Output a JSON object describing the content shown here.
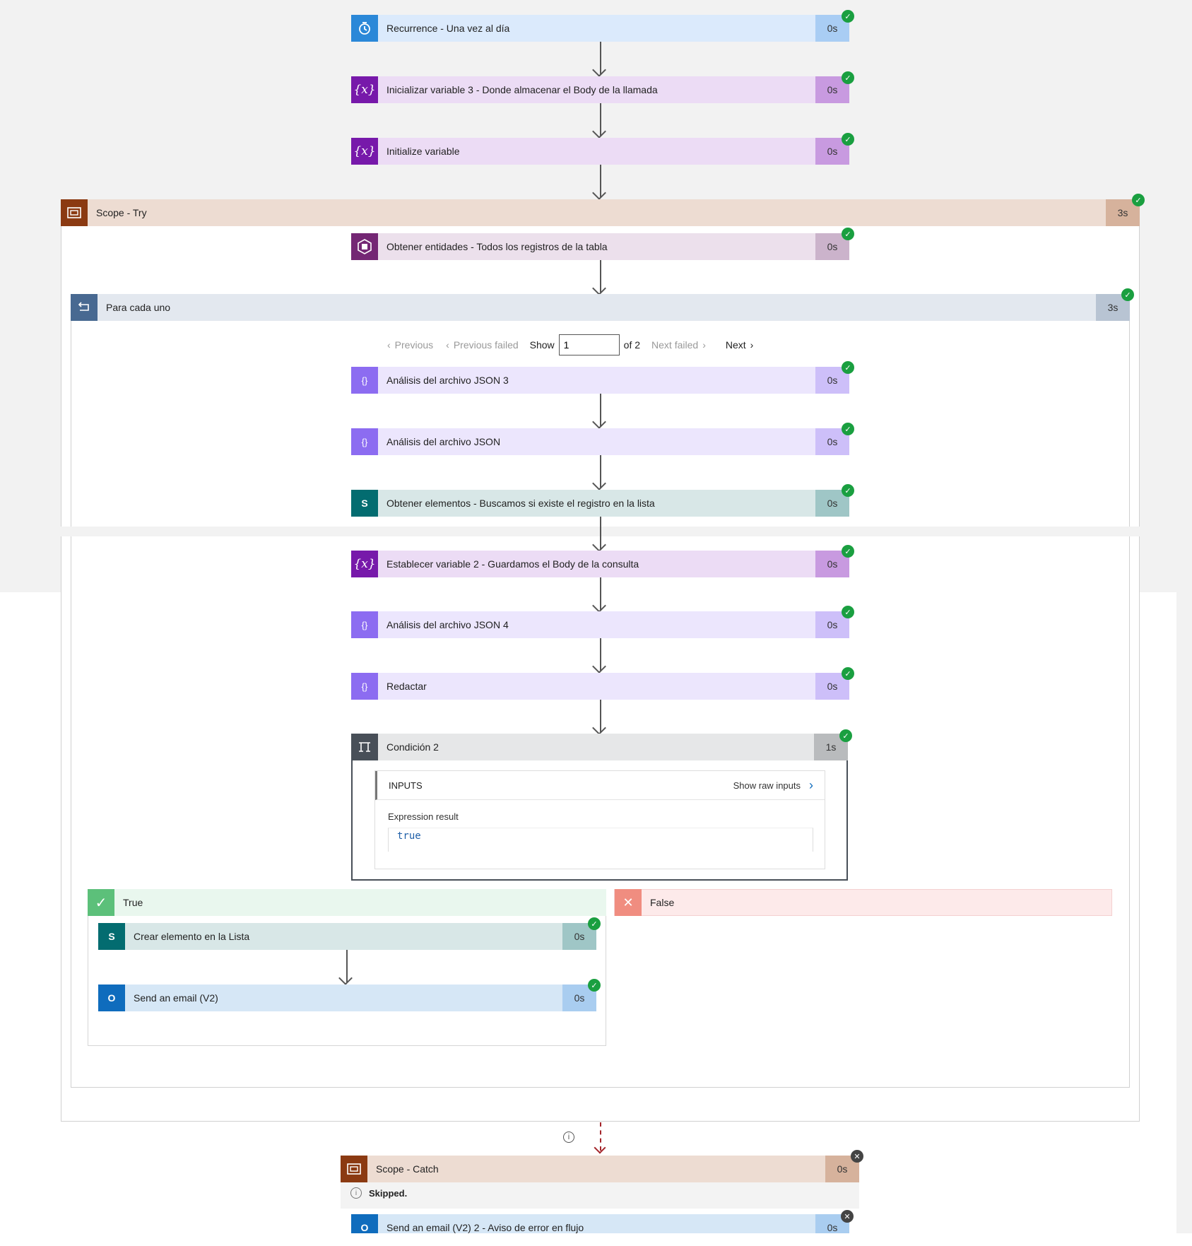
{
  "colors": {
    "recurrence_icon": "#2b88d8",
    "recurrence_bg": "#dbeafc",
    "recurrence_dur": "#a9cdf4",
    "variable_icon": "#7719aa",
    "variable_bg": "#ecdcf5",
    "variable_dur": "#c89ae0",
    "json_icon": "#8c6cf1",
    "json_bg": "#ece6fd",
    "json_dur": "#cdbff9",
    "scope_icon": "#8b3a12",
    "scope_bg": "#eddcd2",
    "scope_dur": "#d6b29c",
    "dataverse_icon": "#742774",
    "dataverse_bg": "#ece0ec",
    "dataverse_dur": "#cbb3cb",
    "sharepoint_icon": "#036c70",
    "sharepoint_bg": "#d8e7e7",
    "sharepoint_dur": "#9fc6c6",
    "foreach_icon": "#486991",
    "foreach_bg": "#e3e8ef",
    "foreach_dur": "#b8c4d3",
    "condition_icon": "#484f58",
    "condition_bg": "#e6e7e8",
    "condition_dur": "#b9bbbd",
    "outlook_icon": "#0f6cbd",
    "outlook_bg": "#d6e7f6",
    "outlook_dur": "#a9cdf0",
    "true_icon": "#5cc07a",
    "true_bg": "#e9f7ee",
    "false_icon": "#f08d80",
    "false_bg": "#fdeaea",
    "success": "#1a9f40"
  },
  "steps": {
    "recurrence": {
      "title": "Recurrence - Una vez al día",
      "duration": "0s",
      "icon": "clock-icon"
    },
    "init_var3": {
      "title": "Inicializar variable 3 - Donde almacenar el Body de la llamada",
      "duration": "0s",
      "icon": "variable-icon"
    },
    "init_var": {
      "title": "Initialize variable",
      "duration": "0s",
      "icon": "variable-icon"
    },
    "scope_try": {
      "title": "Scope - Try",
      "duration": "3s",
      "icon": "scope-icon"
    },
    "obtener_entidades": {
      "title": "Obtener entidades - Todos los registros de la tabla",
      "duration": "0s",
      "icon": "dataverse-icon"
    },
    "para_cada_uno": {
      "title": "Para cada uno",
      "duration": "3s",
      "icon": "loop-icon"
    },
    "json3": {
      "title": "Análisis del archivo JSON 3",
      "duration": "0s",
      "icon": "json-icon"
    },
    "json": {
      "title": "Análisis del archivo JSON",
      "duration": "0s",
      "icon": "json-icon"
    },
    "obtener_elementos": {
      "title": "Obtener elementos - Buscamos si existe el registro en la lista",
      "duration": "0s",
      "icon": "sharepoint-icon"
    },
    "establecer_var2": {
      "title": "Establecer variable 2 - Guardamos el Body de la consulta",
      "duration": "0s",
      "icon": "variable-icon"
    },
    "json4": {
      "title": "Análisis del archivo JSON 4",
      "duration": "0s",
      "icon": "json-icon"
    },
    "redactar": {
      "title": "Redactar",
      "duration": "0s",
      "icon": "json-icon"
    },
    "condicion2": {
      "title": "Condición 2",
      "duration": "1s",
      "icon": "condition-icon"
    },
    "crear_elemento": {
      "title": "Crear elemento en la Lista",
      "duration": "0s",
      "icon": "sharepoint-icon"
    },
    "send_email": {
      "title": "Send an email (V2)",
      "duration": "0s",
      "icon": "outlook-icon"
    },
    "scope_catch": {
      "title": "Scope - Catch",
      "duration": "0s",
      "icon": "scope-icon"
    },
    "send_email2": {
      "title": "Send an email (V2) 2 - Aviso de error en flujo",
      "duration": "0s",
      "icon": "outlook-icon"
    }
  },
  "pager": {
    "previous": "Previous",
    "previous_failed": "Previous failed",
    "show": "Show",
    "current": "1",
    "of_total": "of 2",
    "next_failed": "Next failed",
    "next": "Next"
  },
  "condition": {
    "inputs_label": "INPUTS",
    "show_raw": "Show raw inputs",
    "expr_label": "Expression result",
    "expr_value": "true"
  },
  "branches": {
    "true_label": "True",
    "false_label": "False"
  },
  "catch": {
    "skipped": "Skipped."
  }
}
